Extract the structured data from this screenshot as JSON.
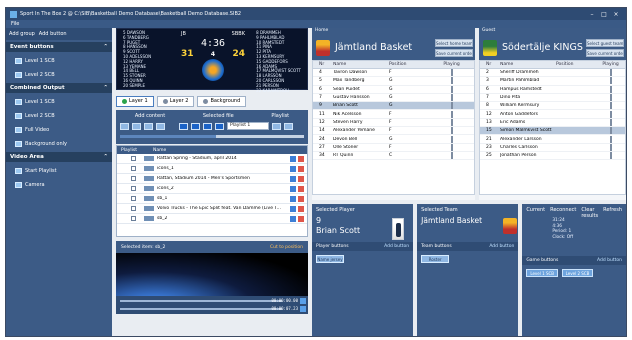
{
  "window": {
    "title": "Sport In The Box 2 @ C:\\SIB\\Basketball Demo Database\\Basketball Demo Database.SIB2"
  },
  "menu": {
    "file": "File"
  },
  "left": {
    "add_group": "Add group",
    "add_button": "Add button",
    "sections": [
      {
        "title": "Event buttons",
        "items": [
          "Level 1 SCB",
          "Level 2 SCB"
        ]
      },
      {
        "title": "Combined Output",
        "items": [
          "Level 1 SCB",
          "Level 2 SCB",
          "Full Video",
          "Background only"
        ]
      },
      {
        "title": "Video Area",
        "items": [
          "Start Playlist",
          "Camera"
        ]
      }
    ]
  },
  "scoreboard": {
    "home_abbr": "JB",
    "guest_abbr": "SBBK",
    "clock": "4:36",
    "period": "4",
    "home_score": "31",
    "guest_score": "24",
    "home_roster": [
      "5 DAWSON",
      "6 TANDBERG",
      "7 PUGET",
      "8 HANSSON",
      "9 SCOTT",
      "10 ADELSSON",
      "12 HARRY",
      "13 YEMANE",
      "14 BELL",
      "15 STONER",
      "16 QUINN",
      "20 SEMPLE"
    ],
    "guest_roster": [
      "8 DRAMMEH",
      "9 PAHLMBLAD",
      "10 RAMSTEDT",
      "11 PINA",
      "12 PITA",
      "13 KERMSURY",
      "15 GADDEFORS",
      "16 ADAMS",
      "17 MALMQVIST SCOTT",
      "18 LARSSON",
      "20 CARLSSON",
      "21 PERSON",
      "22 KARAMITROU"
    ]
  },
  "layers": [
    "Layer 1",
    "Layer 2",
    "Background"
  ],
  "controls": {
    "add_content": "Add content",
    "selected_file": "Selected file",
    "playlist": "Playlist",
    "playlist_value": "Playlist 1"
  },
  "playlist": {
    "headers": [
      "Playlist",
      "Name"
    ],
    "rows": [
      "Rattan Spring - Stadium, april 2014",
      "icons_1",
      "Rattan, Stadium 2014 - Men's Sportsmen",
      "icons_2",
      "sb_1",
      "Volvo Trucks - The Epic Split feat. Van Damme (Live T...",
      "sb_2"
    ]
  },
  "preview": {
    "selected_item": "Selected item: sb_2",
    "cut_label": "Cut to position",
    "time1": "00:00:00.00",
    "time2": "00:00:07.23"
  },
  "home": {
    "label": "Home",
    "name": "Jämtland Basket",
    "btn_select": "Select home team",
    "btn_save": "Save current order",
    "headers": [
      "Nr",
      "Name",
      "Position",
      "Playing"
    ],
    "players": [
      [
        "4",
        "Tavron Dawson",
        "F"
      ],
      [
        "5",
        "Max Tandberg",
        "G"
      ],
      [
        "6",
        "Sean Puidet",
        "G"
      ],
      [
        "7",
        "Gustav Hansson",
        "G"
      ],
      [
        "9",
        "Brian Scott",
        "G"
      ],
      [
        "11",
        "Nik Acelsson",
        "F"
      ],
      [
        "12",
        "Steven Harry",
        "F"
      ],
      [
        "14",
        "Alexander Yemane",
        "F"
      ],
      [
        "24",
        "Devon Bell",
        "G"
      ],
      [
        "27",
        "Olle Stoner",
        "F"
      ],
      [
        "34",
        "RT Quinn",
        "C"
      ]
    ]
  },
  "guest": {
    "label": "Guest",
    "name": "Södertälje KINGS",
    "btn_select": "Select guest team",
    "btn_save": "Save current order",
    "headers": [
      "Nr",
      "Name",
      "Position",
      "Playing"
    ],
    "players": [
      [
        "2",
        "Sheriff Drammeh",
        ""
      ],
      [
        "3",
        "Martin Pahlmblad",
        ""
      ],
      [
        "6",
        "Hampus Ramstedt",
        ""
      ],
      [
        "7",
        "Dino Pita",
        ""
      ],
      [
        "8",
        "William Kermsury",
        ""
      ],
      [
        "12",
        "Anton Gaddefors",
        ""
      ],
      [
        "13",
        "Eric Adams",
        ""
      ],
      [
        "15",
        "Simon Malmkvist Scott",
        ""
      ],
      [
        "21",
        "Alexander Larsson",
        ""
      ],
      [
        "23",
        "Charles Carlsson",
        ""
      ],
      [
        "25",
        "Jonathan Person",
        ""
      ]
    ]
  },
  "selected_player": {
    "title": "Selected Player",
    "number": "9",
    "name": "Brian Scott",
    "buttons_label": "Player buttons",
    "add_button": "Add button",
    "btn": "Name jersey"
  },
  "selected_team": {
    "title": "Selected Team",
    "name": "Jämtland Basket",
    "buttons_label": "Team buttons",
    "add_button": "Add button",
    "btn": "Roster"
  },
  "current": {
    "tabs": [
      "Current",
      "Reconnect",
      "Clear results",
      "Refresh"
    ],
    "stats": [
      "31:24",
      "4:36",
      "Period: 1",
      "Clock: Off"
    ],
    "game_buttons": "Game buttons",
    "add_button": "Add button",
    "level_buttons": [
      "Level 1 SCB",
      "Level 2 SCB"
    ]
  },
  "colors": {
    "panel": "#3c5b86",
    "dark": "#2e4b73",
    "accent": "#4a90e2",
    "selected_row": "#b8c8dc",
    "score_yellow": "#ffd43b"
  }
}
